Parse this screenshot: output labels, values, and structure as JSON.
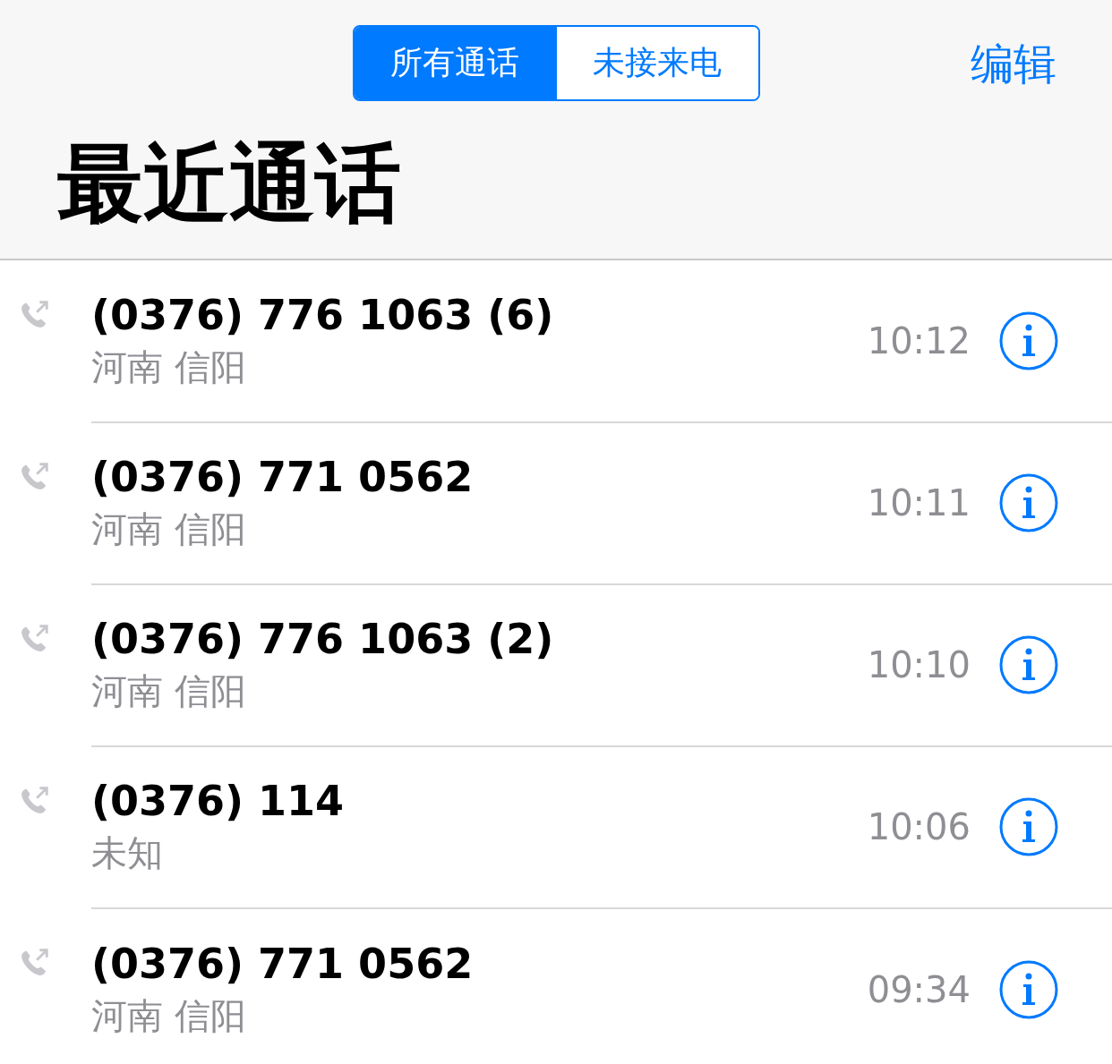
{
  "segments": [
    {
      "label": "所有通话",
      "selected": true
    },
    {
      "label": "未接来电",
      "selected": false
    }
  ],
  "edit_button": "编辑",
  "title": "最近通话",
  "calls": [
    {
      "number": "(0376) 776 1063 (6)",
      "location": "河南 信阳",
      "time": "10:12"
    },
    {
      "number": "(0376) 771 0562",
      "location": "河南 信阳",
      "time": "10:11"
    },
    {
      "number": "(0376) 776 1063 (2)",
      "location": "河南 信阳",
      "time": "10:10"
    },
    {
      "number": "(0376) 114",
      "location": "未知",
      "time": "10:06"
    },
    {
      "number": "(0376) 771 0562",
      "location": "河南 信阳",
      "time": "09:34"
    }
  ]
}
